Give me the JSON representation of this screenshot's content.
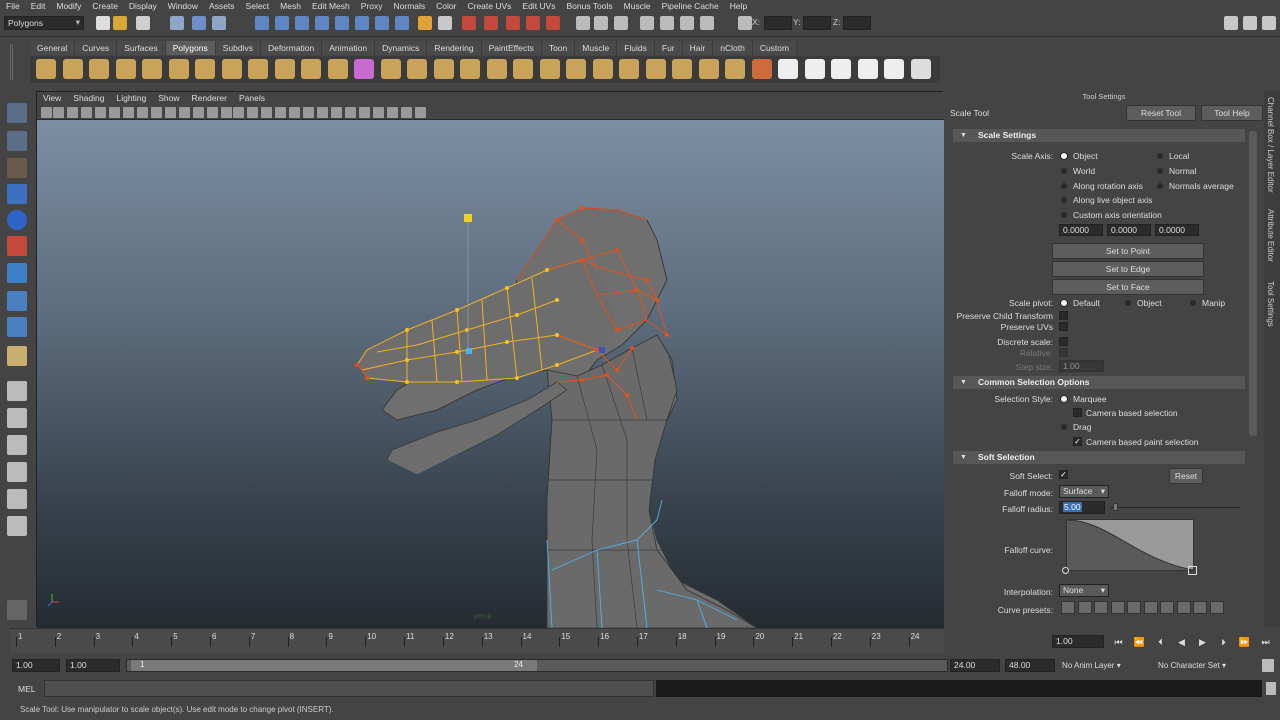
{
  "menu": [
    "File",
    "Edit",
    "Modify",
    "Create",
    "Display",
    "Window",
    "Assets",
    "Select",
    "Mesh",
    "Edit Mesh",
    "Proxy",
    "Normals",
    "Color",
    "Create UVs",
    "Edit UVs",
    "Bonus Tools",
    "Muscle",
    "Pipeline Cache",
    "Help"
  ],
  "status": {
    "mode": "Polygons",
    "x_label": "X:",
    "y_label": "Y:",
    "z_label": "Z:"
  },
  "shelf_tabs": [
    "General",
    "Curves",
    "Surfaces",
    "Polygons",
    "Subdivs",
    "Deformation",
    "Animation",
    "Dynamics",
    "Rendering",
    "PaintEffects",
    "Toon",
    "Muscle",
    "Fluids",
    "Fur",
    "Hair",
    "nCloth",
    "Custom"
  ],
  "shelf_active": "Polygons",
  "viewport_menu": [
    "View",
    "Shading",
    "Lighting",
    "Show",
    "Renderer",
    "Panels"
  ],
  "viewport_label": "persp",
  "panel": {
    "title": "Tool Settings",
    "tool_name": "Scale Tool",
    "reset_tool": "Reset Tool",
    "tool_help": "Tool Help",
    "scale_settings": {
      "header": "Scale Settings",
      "axis_label": "Scale Axis:",
      "opt_object": "Object",
      "opt_local": "Local",
      "opt_world": "World",
      "opt_normal": "Normal",
      "opt_along_rot": "Along rotation axis",
      "opt_normals_avg": "Normals average",
      "opt_along_live": "Along live object axis",
      "opt_custom": "Custom axis orientation",
      "v1": "0.0000",
      "v2": "0.0000",
      "v3": "0.0000",
      "set_point": "Set to Point",
      "set_edge": "Set to Edge",
      "set_face": "Set to Face",
      "pivot_label": "Scale pivot:",
      "pivot_default": "Default",
      "pivot_object": "Object",
      "pivot_manip": "Manip",
      "preserve_child": "Preserve Child Transform",
      "preserve_uvs": "Preserve UVs",
      "discrete": "Discrete scale:",
      "relative": "Relative:",
      "step_size": "Step size:",
      "step_value": "1.00"
    },
    "common_sel": {
      "header": "Common Selection Options",
      "style_label": "Selection Style:",
      "marquee": "Marquee",
      "camera_based": "Camera based selection",
      "drag": "Drag",
      "camera_paint": "Camera based paint selection"
    },
    "soft_sel": {
      "header": "Soft Selection",
      "soft_select": "Soft Select:",
      "reset": "Reset",
      "falloff_mode": "Falloff mode:",
      "falloff_mode_val": "Surface",
      "falloff_radius": "Falloff radius:",
      "falloff_radius_val": "5.00",
      "falloff_curve": "Falloff curve:",
      "interpolation": "Interpolation:",
      "interpolation_val": "None",
      "curve_presets": "Curve presets:"
    }
  },
  "side_tabs": [
    "Channel Box / Layer Editor",
    "Attribute Editor",
    "Tool Settings"
  ],
  "timeline": {
    "ticks": [
      "1",
      "2",
      "3",
      "4",
      "5",
      "6",
      "7",
      "8",
      "9",
      "10",
      "11",
      "12",
      "13",
      "14",
      "15",
      "16",
      "17",
      "18",
      "19",
      "20",
      "21",
      "22",
      "23",
      "24"
    ],
    "current": "1.00"
  },
  "range": {
    "start": "1.00",
    "start2": "1.00",
    "slider_start": "1",
    "slider_end": "24",
    "end": "24.00",
    "end2": "48.00",
    "anim_layer": "No Anim Layer",
    "char_set": "No Character Set"
  },
  "cmd_label": "MEL",
  "help_text": "Scale Tool: Use manipulator to scale object(s). Use edit mode to change pivot (INSERT)."
}
